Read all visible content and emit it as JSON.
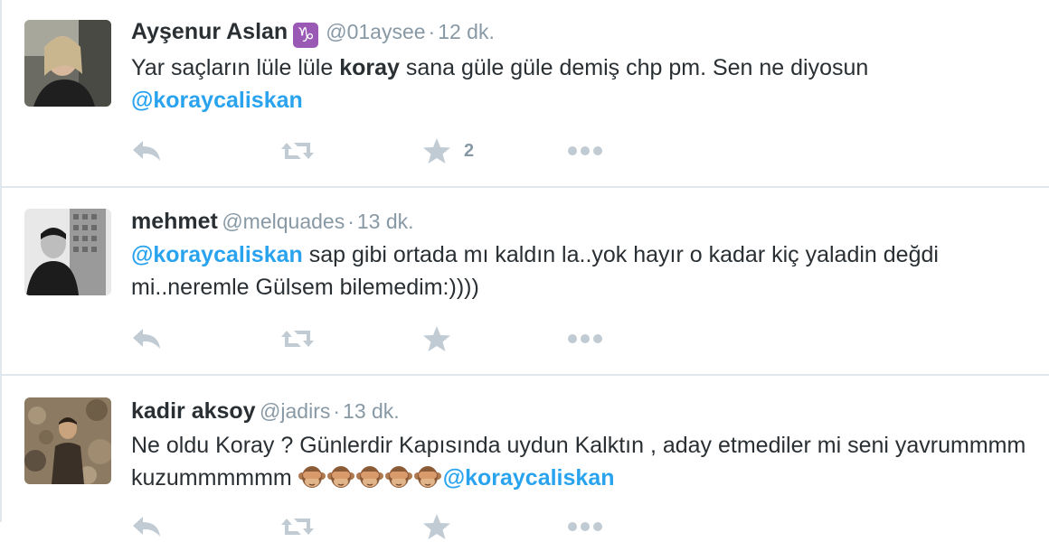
{
  "tweets": [
    {
      "name": "Ayşenur Aslan",
      "badge": "♑",
      "handle": "@01aysee",
      "separator": "·",
      "time": "12 dk.",
      "text_parts": [
        "Yar saçların lüle lüle ",
        "koray",
        " sana güle güle demiş chp pm. Sen ne diyosun "
      ],
      "mention": "@koraycaliskan",
      "favorite_count": "2"
    },
    {
      "name": "mehmet",
      "handle": "@melquades",
      "separator": "·",
      "time": "13 dk.",
      "mention": "@koraycaliskan",
      "text": " sap gibi ortada mı kaldın la..yok hayır o kadar kiç yaladin değdi mi..neremle Gülsem bilemedim:))))"
    },
    {
      "name": "kadir aksoy",
      "handle": "@jadirs",
      "separator": "·",
      "time": "13 dk.",
      "text": "Ne oldu Koray ? Günlerdir Kapısında uydun Kalktın , aday etmediler mi seni yavrummmm kuzummmmmm ",
      "emoji_count": 5,
      "mention": "@koraycaliskan"
    }
  ],
  "icons": {
    "reply": "reply-icon",
    "retweet": "retweet-icon",
    "favorite": "star-icon",
    "more": "more-icon"
  },
  "colors": {
    "link": "#2aa3ef",
    "muted": "#8899a6",
    "action_icon": "#c0cbd4",
    "divider": "#e1e8ed",
    "badge": "#9b59b6"
  }
}
